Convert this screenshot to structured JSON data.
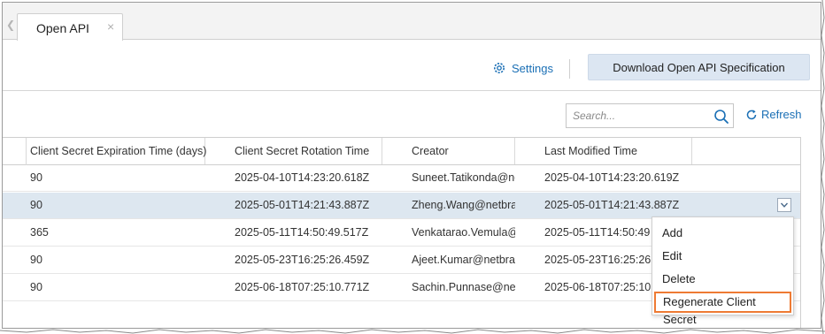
{
  "tabs": [
    {
      "label": "Open API",
      "close_glyph": "×"
    }
  ],
  "toolbar": {
    "settings_label": "Settings",
    "download_label": "Download Open API Specification"
  },
  "search": {
    "placeholder": "Search...",
    "value": ""
  },
  "refresh_label": "Refresh",
  "table": {
    "columns": [
      "Client Secret Expiration Time (days)",
      "Client Secret Rotation Time",
      "Creator",
      "Last Modified Time"
    ],
    "rows": [
      {
        "expiration": "90",
        "rotation": "2025-04-10T14:23:20.618Z",
        "creator": "Suneet.Tatikonda@net...",
        "modified": "2025-04-10T14:23:20.619Z"
      },
      {
        "expiration": "90",
        "rotation": "2025-05-01T14:21:43.887Z",
        "creator": "Zheng.Wang@netbrain...",
        "modified": "2025-05-01T14:21:43.887Z"
      },
      {
        "expiration": "365",
        "rotation": "2025-05-11T14:50:49.517Z",
        "creator": "Venkatarao.Vemula@n...",
        "modified": "2025-05-11T14:50:49"
      },
      {
        "expiration": "90",
        "rotation": "2025-05-23T16:25:26.459Z",
        "creator": "Ajeet.Kumar@netbrain...",
        "modified": "2025-05-23T16:25:26"
      },
      {
        "expiration": "90",
        "rotation": "2025-06-18T07:25:10.771Z",
        "creator": "Sachin.Punnase@netbr...",
        "modified": "2025-06-18T07:25:10"
      }
    ],
    "selected_row": 1
  },
  "context_menu": {
    "items": [
      "Add",
      "Edit",
      "Delete",
      "Regenerate Client Secret"
    ],
    "highlighted": "Regenerate Client Secret"
  },
  "colors": {
    "link": "#1a6fb5",
    "selected_row": "#dde7f0",
    "download_button": "#dce6f2",
    "highlight_border": "#ee7a33"
  },
  "icons": [
    "gear-icon",
    "search-icon",
    "refresh-icon",
    "chevron-down-icon",
    "close-icon",
    "chevron-left-icon"
  ]
}
